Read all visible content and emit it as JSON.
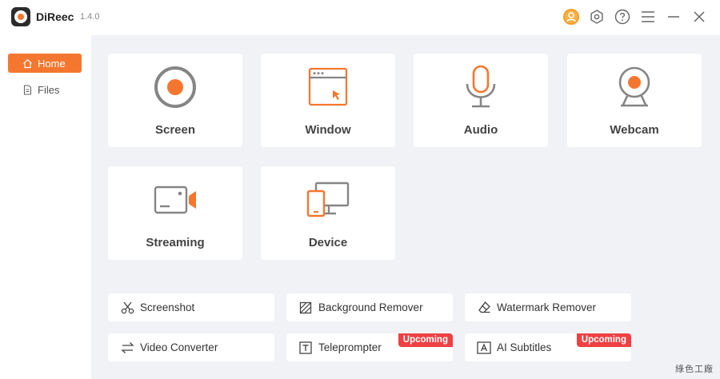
{
  "app": {
    "name": "DiReec",
    "version": "1.4.0"
  },
  "titlebar": {
    "icons": [
      "user-account-icon",
      "settings-icon",
      "help-icon",
      "menu-icon",
      "minimize-icon",
      "close-icon"
    ]
  },
  "sidebar": {
    "items": [
      {
        "label": "Home",
        "icon": "home-icon",
        "active": true
      },
      {
        "label": "Files",
        "icon": "file-icon",
        "active": false
      }
    ]
  },
  "recorders": [
    {
      "label": "Screen",
      "icon": "screen-record-icon"
    },
    {
      "label": "Window",
      "icon": "window-icon"
    },
    {
      "label": "Audio",
      "icon": "microphone-icon"
    },
    {
      "label": "Webcam",
      "icon": "webcam-icon"
    },
    {
      "label": "Streaming",
      "icon": "streaming-camera-icon"
    },
    {
      "label": "Device",
      "icon": "device-icon"
    }
  ],
  "tools": [
    {
      "label": "Screenshot",
      "icon": "scissors-icon",
      "badge": ""
    },
    {
      "label": "Background Remover",
      "icon": "background-remover-icon",
      "badge": ""
    },
    {
      "label": "Watermark Remover",
      "icon": "eraser-icon",
      "badge": ""
    },
    {
      "label": "Video Converter",
      "icon": "convert-arrows-icon",
      "badge": ""
    },
    {
      "label": "Teleprompter",
      "icon": "text-t-icon",
      "badge": "Upcoming"
    },
    {
      "label": "AI Subtitles",
      "icon": "text-a-icon",
      "badge": "Upcoming"
    }
  ],
  "watermark": "綠色工廠",
  "colors": {
    "accent": "#f5772f",
    "badge": "#ef4043",
    "background": "#f1f2f6"
  }
}
